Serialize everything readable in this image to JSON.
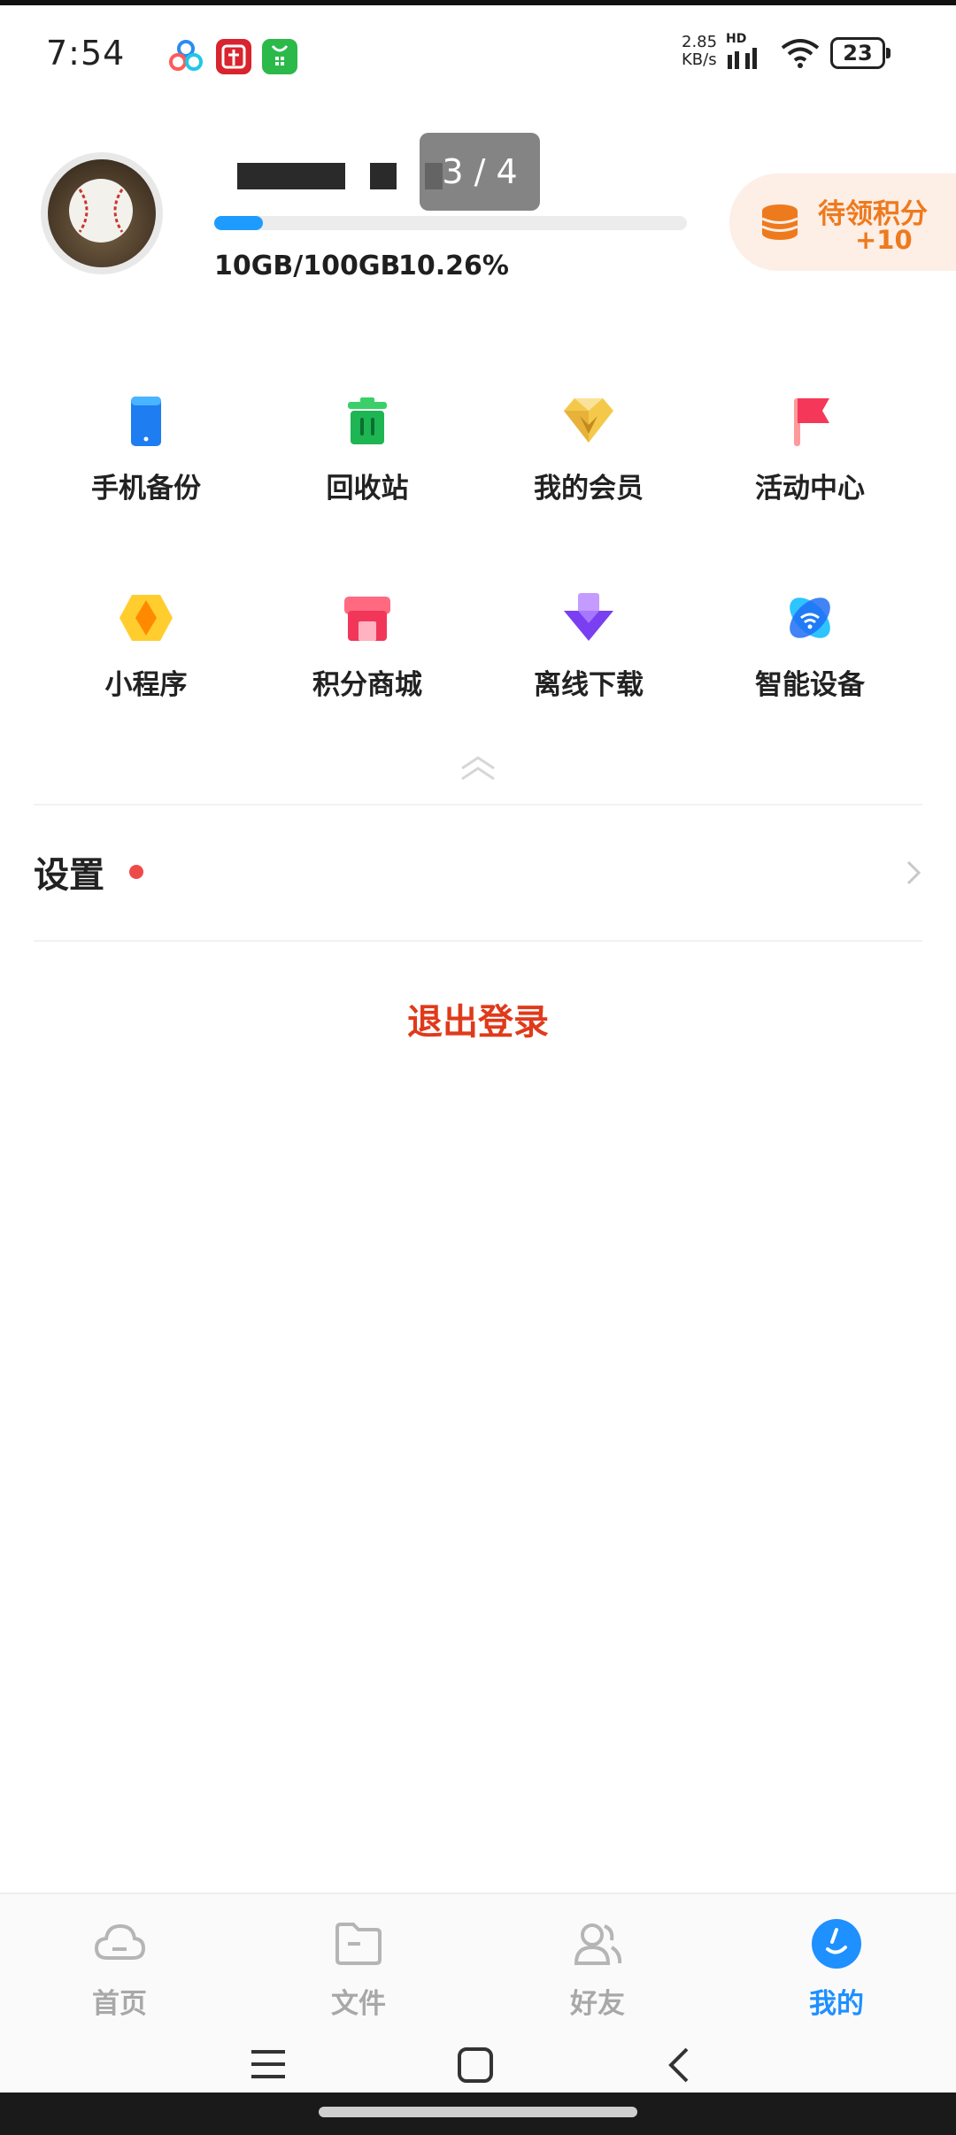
{
  "status_bar": {
    "time": "7:54",
    "net_speed_value": "2.85",
    "net_speed_unit": "KB/s",
    "hd_label": "HD",
    "battery": "23"
  },
  "profile": {
    "page_indicator": "3 / 4",
    "quota_used": "10GB/100GB",
    "quota_percent": "10.26%",
    "quota_fraction": 0.1026,
    "points_label": "待领积分",
    "points_value": "+10"
  },
  "grid": [
    {
      "label": "手机备份",
      "icon": "phone-backup-icon"
    },
    {
      "label": "回收站",
      "icon": "recycle-bin-icon"
    },
    {
      "label": "我的会员",
      "icon": "membership-diamond-icon"
    },
    {
      "label": "活动中心",
      "icon": "activity-flag-icon"
    },
    {
      "label": "小程序",
      "icon": "mini-program-icon"
    },
    {
      "label": "积分商城",
      "icon": "points-mall-icon"
    },
    {
      "label": "离线下载",
      "icon": "offline-download-icon"
    },
    {
      "label": "智能设备",
      "icon": "smart-device-icon"
    }
  ],
  "settings": {
    "label": "设置"
  },
  "logout": {
    "label": "退出登录"
  },
  "tabs": [
    {
      "label": "首页",
      "icon": "cloud-icon"
    },
    {
      "label": "文件",
      "icon": "folder-icon"
    },
    {
      "label": "好友",
      "icon": "friends-icon"
    },
    {
      "label": "我的",
      "icon": "profile-icon",
      "active": true
    }
  ],
  "colors": {
    "accent_blue": "#1e90ff",
    "logout_red": "#e03a1a",
    "points_orange": "#ee7a1e",
    "points_bg": "#fdeee6",
    "notify_dot": "#ef4a4a"
  }
}
